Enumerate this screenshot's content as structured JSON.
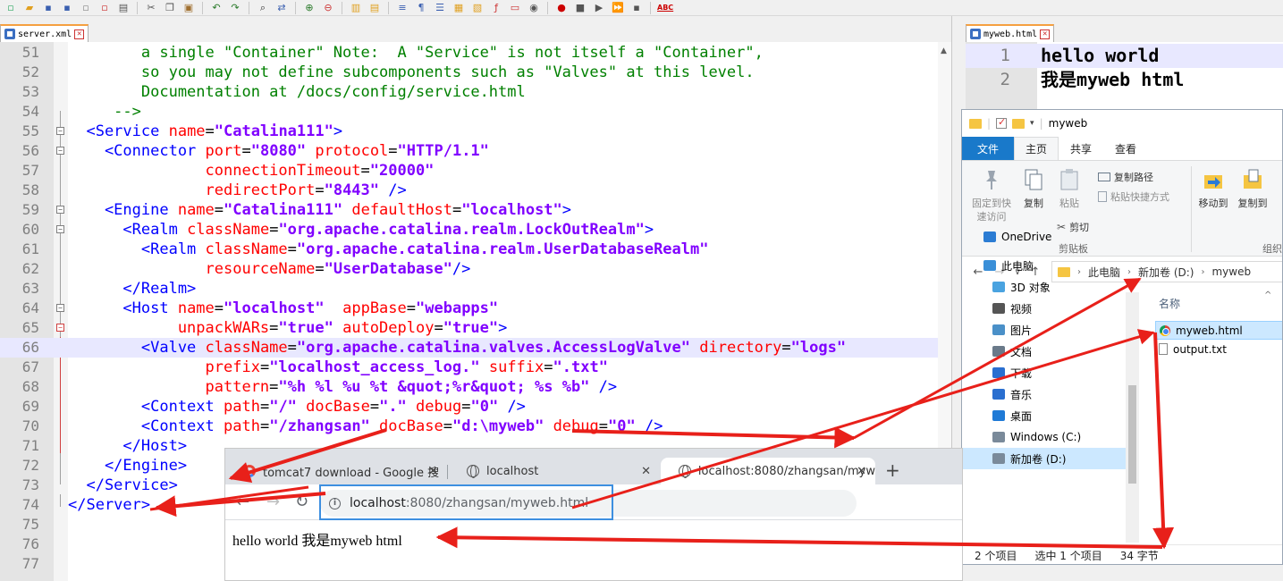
{
  "toolbar": {
    "spellcheck_label": "ABC"
  },
  "left_tab": {
    "label": "server.xml"
  },
  "right_tab": {
    "label": "myweb.html"
  },
  "editor_lines": [
    {
      "n": "51",
      "fold": "none",
      "parts": [
        [
          "c-comment",
          "        a single \"Container\" Note:  A \"Service\" is not itself a \"Container\","
        ]
      ]
    },
    {
      "n": "52",
      "fold": "none",
      "parts": [
        [
          "c-comment",
          "        so you may not define subcomponents such as \"Valves\" at this level."
        ]
      ]
    },
    {
      "n": "53",
      "fold": "none",
      "parts": [
        [
          "c-comment",
          "        Documentation at /docs/config/service.html"
        ]
      ]
    },
    {
      "n": "54",
      "fold": "none",
      "parts": [
        [
          "c-comment",
          "     -->"
        ]
      ]
    },
    {
      "n": "55",
      "fold": "minus",
      "parts": [
        [
          "c-tag",
          "  <Service "
        ],
        [
          "c-attr",
          "name"
        ],
        [
          "c-eq",
          "="
        ],
        [
          "c-val",
          "\"Catalina111\""
        ],
        [
          "c-tag",
          ">"
        ]
      ]
    },
    {
      "n": "56",
      "fold": "minus",
      "parts": [
        [
          "c-tag",
          "    <Connector "
        ],
        [
          "c-attr",
          "port"
        ],
        [
          "c-eq",
          "="
        ],
        [
          "c-val",
          "\"8080\""
        ],
        [
          "c-tag",
          " "
        ],
        [
          "c-attr",
          "protocol"
        ],
        [
          "c-eq",
          "="
        ],
        [
          "c-val",
          "\"HTTP/1.1\""
        ]
      ]
    },
    {
      "n": "57",
      "fold": "none",
      "parts": [
        [
          "c-attr",
          "               connectionTimeout"
        ],
        [
          "c-eq",
          "="
        ],
        [
          "c-val",
          "\"20000\""
        ]
      ]
    },
    {
      "n": "58",
      "fold": "none",
      "parts": [
        [
          "c-attr",
          "               redirectPort"
        ],
        [
          "c-eq",
          "="
        ],
        [
          "c-val",
          "\"8443\""
        ],
        [
          "c-tag",
          " />"
        ]
      ]
    },
    {
      "n": "59",
      "fold": "minus",
      "parts": [
        [
          "c-tag",
          "    <Engine "
        ],
        [
          "c-attr",
          "name"
        ],
        [
          "c-eq",
          "="
        ],
        [
          "c-val",
          "\"Catalina111\""
        ],
        [
          "c-tag",
          " "
        ],
        [
          "c-attr",
          "defaultHost"
        ],
        [
          "c-eq",
          "="
        ],
        [
          "c-val",
          "\"localhost\""
        ],
        [
          "c-tag",
          ">"
        ]
      ]
    },
    {
      "n": "60",
      "fold": "minus",
      "parts": [
        [
          "c-tag",
          "      <Realm "
        ],
        [
          "c-attr",
          "className"
        ],
        [
          "c-eq",
          "="
        ],
        [
          "c-val",
          "\"org.apache.catalina.realm.LockOutRealm\""
        ],
        [
          "c-tag",
          ">"
        ]
      ]
    },
    {
      "n": "61",
      "fold": "none",
      "parts": [
        [
          "c-tag",
          "        <Realm "
        ],
        [
          "c-attr",
          "className"
        ],
        [
          "c-eq",
          "="
        ],
        [
          "c-val",
          "\"org.apache.catalina.realm.UserDatabaseRealm\""
        ]
      ]
    },
    {
      "n": "62",
      "fold": "none",
      "parts": [
        [
          "c-attr",
          "               resourceName"
        ],
        [
          "c-eq",
          "="
        ],
        [
          "c-val",
          "\"UserDatabase\""
        ],
        [
          "c-tag",
          "/>"
        ]
      ]
    },
    {
      "n": "63",
      "fold": "none",
      "parts": [
        [
          "c-tag",
          "      </Realm>"
        ]
      ]
    },
    {
      "n": "64",
      "fold": "minus",
      "parts": [
        [
          "c-tag",
          "      <Host "
        ],
        [
          "c-attr",
          "name"
        ],
        [
          "c-eq",
          "="
        ],
        [
          "c-val",
          "\"localhost\""
        ],
        [
          "c-tag",
          "  "
        ],
        [
          "c-attr",
          "appBase"
        ],
        [
          "c-eq",
          "="
        ],
        [
          "c-val",
          "\"webapps\""
        ]
      ]
    },
    {
      "n": "65",
      "fold": "minus-red",
      "parts": [
        [
          "c-attr",
          "            unpackWARs"
        ],
        [
          "c-eq",
          "="
        ],
        [
          "c-val",
          "\"true\""
        ],
        [
          "c-tag",
          " "
        ],
        [
          "c-attr",
          "autoDeploy"
        ],
        [
          "c-eq",
          "="
        ],
        [
          "c-val",
          "\"true\""
        ],
        [
          "c-tag",
          ">"
        ]
      ]
    },
    {
      "n": "66",
      "fold": "none",
      "hl": true,
      "parts": [
        [
          "c-tag",
          "        <Valve "
        ],
        [
          "c-attr",
          "className"
        ],
        [
          "c-eq",
          "="
        ],
        [
          "c-val",
          "\"org.apache.catalina.valves.AccessLogValve\""
        ],
        [
          "c-tag",
          " "
        ],
        [
          "c-attr",
          "directory"
        ],
        [
          "c-eq",
          "="
        ],
        [
          "c-val",
          "\"logs\""
        ]
      ]
    },
    {
      "n": "67",
      "fold": "none",
      "parts": [
        [
          "c-attr",
          "               prefix"
        ],
        [
          "c-eq",
          "="
        ],
        [
          "c-val",
          "\"localhost_access_log.\""
        ],
        [
          "c-tag",
          " "
        ],
        [
          "c-attr",
          "suffix"
        ],
        [
          "c-eq",
          "="
        ],
        [
          "c-val",
          "\".txt\""
        ]
      ]
    },
    {
      "n": "68",
      "fold": "none",
      "parts": [
        [
          "c-attr",
          "               pattern"
        ],
        [
          "c-eq",
          "="
        ],
        [
          "c-val",
          "\"%h %l %u %t &quot;%r&quot; %s %b\""
        ],
        [
          "c-tag",
          " />"
        ]
      ]
    },
    {
      "n": "69",
      "fold": "none",
      "parts": [
        [
          "c-tag",
          "        <Context "
        ],
        [
          "c-attr",
          "path"
        ],
        [
          "c-eq",
          "="
        ],
        [
          "c-val",
          "\"/\""
        ],
        [
          "c-tag",
          " "
        ],
        [
          "c-attr",
          "docBase"
        ],
        [
          "c-eq",
          "="
        ],
        [
          "c-val",
          "\".\""
        ],
        [
          "c-tag",
          " "
        ],
        [
          "c-attr",
          "debug"
        ],
        [
          "c-eq",
          "="
        ],
        [
          "c-val",
          "\"0\""
        ],
        [
          "c-tag",
          " />"
        ]
      ]
    },
    {
      "n": "70",
      "fold": "none",
      "parts": [
        [
          "c-tag",
          "        <Context "
        ],
        [
          "c-attr",
          "path"
        ],
        [
          "c-eq",
          "="
        ],
        [
          "c-val",
          "\"/zhangsan\""
        ],
        [
          "c-tag",
          " "
        ],
        [
          "c-attr",
          "docBase"
        ],
        [
          "c-eq",
          "="
        ],
        [
          "c-val",
          "\"d:\\myweb\""
        ],
        [
          "c-tag",
          " "
        ],
        [
          "c-attr",
          "debug"
        ],
        [
          "c-eq",
          "="
        ],
        [
          "c-val",
          "\"0\""
        ],
        [
          "c-tag",
          " />"
        ]
      ]
    },
    {
      "n": "71",
      "fold": "none",
      "parts": [
        [
          "c-tag",
          "      </Host>"
        ]
      ]
    },
    {
      "n": "72",
      "fold": "none",
      "parts": [
        [
          "c-tag",
          "    </Engine>"
        ]
      ]
    },
    {
      "n": "73",
      "fold": "none",
      "parts": [
        [
          "c-tag",
          "  </Service>"
        ]
      ]
    },
    {
      "n": "74",
      "fold": "none",
      "parts": [
        [
          "c-tag",
          "</Server>"
        ]
      ]
    },
    {
      "n": "75",
      "fold": "none",
      "parts": []
    },
    {
      "n": "76",
      "fold": "none",
      "parts": []
    },
    {
      "n": "77",
      "fold": "none",
      "parts": []
    }
  ],
  "right_editor_lines": [
    {
      "n": "1",
      "text": "hello world",
      "hl": true
    },
    {
      "n": "2",
      "text": "我是myweb html",
      "hl": false
    }
  ],
  "explorer": {
    "title": "myweb",
    "tabs": {
      "file": "文件",
      "home": "主页",
      "share": "共享",
      "view": "查看"
    },
    "ribbon": {
      "pin_line1": "固定到快",
      "pin_line2": "速访问",
      "copy": "复制",
      "paste": "粘贴",
      "copy_path": "复制路径",
      "paste_shortcut": "粘贴快捷方式",
      "cut": "剪切",
      "clipboard_group": "剪贴板",
      "move_to": "移动到",
      "copy_to": "复制到",
      "organize_group": "组织"
    },
    "address": {
      "crumb1": "此电脑",
      "crumb2": "新加卷 (D:)",
      "crumb3": "myweb"
    },
    "nav_items": [
      {
        "label": "OneDrive",
        "icon": "cloud-icon",
        "color": "#2b7cd3"
      },
      {
        "label": "此电脑",
        "icon": "computer-icon",
        "color": "#3a8fd8"
      },
      {
        "label": "3D 对象",
        "icon": "cube-icon",
        "color": "#4aa3e0"
      },
      {
        "label": "视频",
        "icon": "video-icon",
        "color": "#555555"
      },
      {
        "label": "图片",
        "icon": "picture-icon",
        "color": "#4a90c8"
      },
      {
        "label": "文档",
        "icon": "document-icon",
        "color": "#6a7a8a"
      },
      {
        "label": "下载",
        "icon": "download-icon",
        "color": "#2a6fd0"
      },
      {
        "label": "音乐",
        "icon": "music-icon",
        "color": "#2a6fd0"
      },
      {
        "label": "桌面",
        "icon": "desktop-icon",
        "color": "#1f7ad6"
      },
      {
        "label": "Windows (C:)",
        "icon": "drive-c-icon",
        "color": "#7a8a9a"
      },
      {
        "label": "新加卷 (D:)",
        "icon": "drive-d-icon",
        "color": "#7a8a9a"
      }
    ],
    "column_header": "名称",
    "files": [
      {
        "name": "myweb.html",
        "type": "chrome"
      },
      {
        "name": "output.txt",
        "type": "txt"
      }
    ],
    "status": {
      "count": "2 个项目",
      "selected": "选中 1 个项目",
      "size": "34 字节"
    }
  },
  "chrome": {
    "tabs": [
      {
        "title": "tomcat7 download - Google 搜",
        "icon": "google-icon"
      },
      {
        "title": "localhost",
        "icon": "globe-icon"
      },
      {
        "title": "localhost:8080/zhangsan/myw",
        "icon": "globe-icon"
      }
    ],
    "url_host": "localhost",
    "url_path": ":8080/zhangsan/myweb.html",
    "page_text": "hello world 我是myweb html"
  },
  "annotation_color": "#e8201a",
  "highlight_color": "#3d8fe0"
}
